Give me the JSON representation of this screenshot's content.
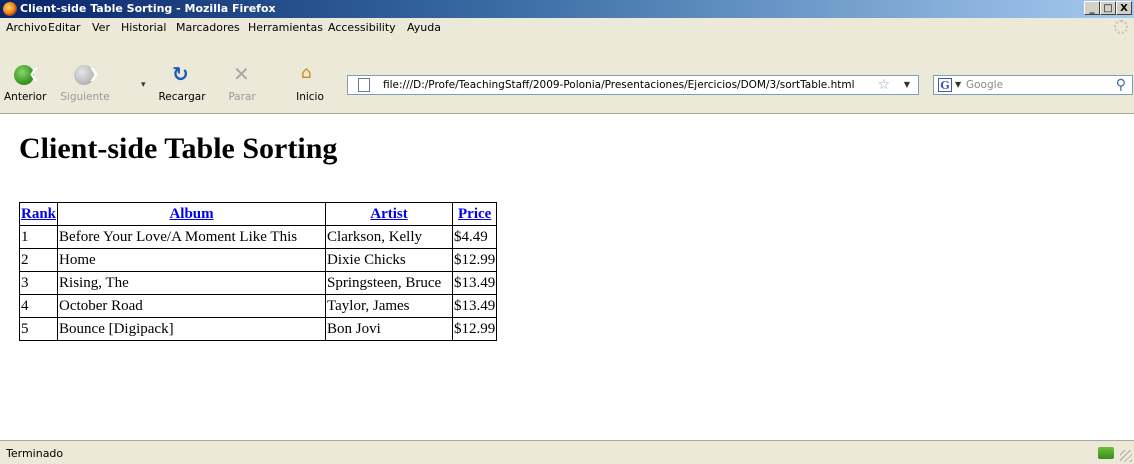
{
  "window": {
    "title": "Client-side Table Sorting - Mozilla Firefox",
    "controls": [
      "_",
      "□",
      "X"
    ]
  },
  "menu": [
    "Archivo",
    "Editar",
    "Ver",
    "Historial",
    "Marcadores",
    "Herramientas",
    "Accessibility",
    "Ayuda"
  ],
  "toolbar": {
    "back_label": "Anterior",
    "forward_label": "Siguiente",
    "reload_label": "Recargar",
    "stop_label": "Parar",
    "home_label": "Inicio"
  },
  "address": {
    "url": "file:///D:/Profe/TeachingStaff/2009-Polonia/Presentaciones/Ejercicios/DOM/3/sortTable.html"
  },
  "search": {
    "engine_letter": "G",
    "placeholder": "Google"
  },
  "page": {
    "heading": "Client-side Table Sorting",
    "table": {
      "headers": [
        "Rank",
        "Album",
        "Artist",
        "Price"
      ],
      "rows": [
        [
          "1",
          "Before Your Love/A Moment Like This",
          "Clarkson, Kelly",
          "$4.49"
        ],
        [
          "2",
          "Home",
          "Dixie Chicks",
          "$12.99"
        ],
        [
          "3",
          "Rising, The",
          "Springsteen, Bruce",
          "$13.49"
        ],
        [
          "4",
          "October Road",
          "Taylor, James",
          "$13.49"
        ],
        [
          "5",
          "Bounce [Digipack]",
          "Bon Jovi",
          "$12.99"
        ]
      ]
    }
  },
  "statusbar": {
    "text": "Terminado"
  }
}
